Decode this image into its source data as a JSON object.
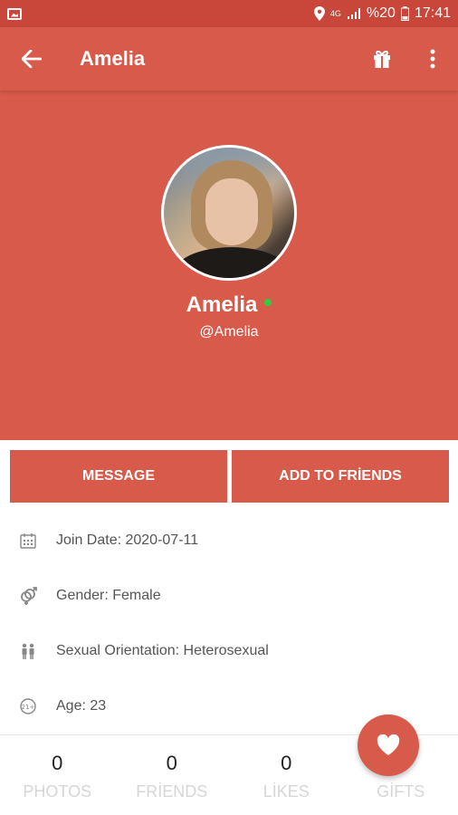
{
  "status_bar": {
    "battery_pct": "%20",
    "time": "17:41",
    "network": "4G"
  },
  "app_bar": {
    "title": "Amelia",
    "icons": [
      "arrow-back-icon",
      "gift-icon",
      "more-vert-icon"
    ]
  },
  "profile": {
    "name": "Amelia",
    "handle": "@Amelia",
    "online": true,
    "online_color": "#2ecc40"
  },
  "actions": {
    "message_label": "MESSAGE",
    "add_friend_label": "ADD TO FRİENDS"
  },
  "info": [
    {
      "icon": "calendar-icon",
      "text": "Join Date: 2020-07-11"
    },
    {
      "icon": "gender-icon",
      "text": "Gender: Female"
    },
    {
      "icon": "people-icon",
      "text": "Sexual Orientation: Heterosexual"
    },
    {
      "icon": "age-badge-icon",
      "icon_text": "21+",
      "text": "Age: 23"
    }
  ],
  "stats": [
    {
      "value": "0",
      "label": "PHOTOS"
    },
    {
      "value": "0",
      "label": "FRİENDS"
    },
    {
      "value": "0",
      "label": "LİKES"
    },
    {
      "value": "",
      "label": "GİFTS"
    }
  ],
  "colors": {
    "accent": "#d85a4a",
    "status_bar": "#c8463a",
    "stat_label": "#d6d6d6"
  }
}
